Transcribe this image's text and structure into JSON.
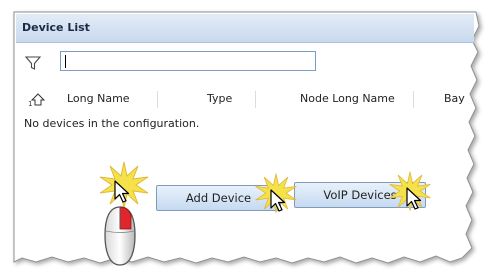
{
  "window": {
    "title": "Device List"
  },
  "filter": {
    "icon": "filter-icon",
    "value": "",
    "placeholder": ""
  },
  "grid": {
    "sort_icon": "sort-up-arrow-icon",
    "columns": [
      "Long Name",
      "Type",
      "Node Long Name",
      "Bay"
    ],
    "empty_message": "No devices in the configuration."
  },
  "buttons": {
    "add_device": "Add Device",
    "voip_devices": "VoIP Devices"
  },
  "annotations": {
    "mouse_icon": "mouse-left-click-icon",
    "click_burst_color": "#f5e24a",
    "mouse_button_color": "#e0262b"
  },
  "colors": {
    "title_bar": "#c9d9ee",
    "button_border": "#7f9db9",
    "input_border": "#7a9cc6"
  }
}
